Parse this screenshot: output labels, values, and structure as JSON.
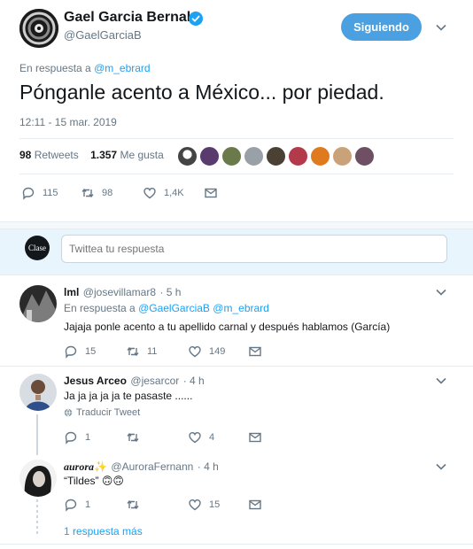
{
  "tweet": {
    "author_name": "Gael Garcia Bernal",
    "author_handle": "@GaelGarciaB",
    "follow_label": "Siguiendo",
    "reply_prefix": "En respuesta a",
    "reply_to": "@m_ebrard",
    "text": "Pónganle acento a México... por piedad.",
    "timestamp": "12:11 - 15 mar. 2019",
    "retweets_count": "98",
    "retweets_label": "Retweets",
    "likes_count": "1.357",
    "likes_label": "Me gusta",
    "actions": {
      "replies": "115",
      "retweets": "98",
      "likes": "1,4K"
    }
  },
  "compose": {
    "avatar_text": "Clase",
    "placeholder": "Twittea tu respuesta"
  },
  "replies": [
    {
      "name": "lml",
      "handle": "@josevillamar8",
      "time": "· 5 h",
      "reply_prefix": "En respuesta a",
      "reply_to_1": "@GaelGarciaB",
      "reply_to_2": "@m_ebrard",
      "text": "Jajaja ponle acento a tu apellido carnal y después hablamos (García)",
      "replies": "15",
      "retweets": "11",
      "likes": "149"
    },
    {
      "name": "Jesus Arceo",
      "handle": "@jesarcor",
      "time": "· 4 h",
      "text": "Ja ja ja ja ja te pasaste ......",
      "translate": "Traducir Tweet",
      "replies": "1",
      "retweets": "",
      "likes": "4"
    },
    {
      "name": "aurora",
      "name_emoji": "✨",
      "handle": "@AuroraFernann",
      "time": "· 4 h",
      "text": "“Tildes” 🙃🙃",
      "replies": "1",
      "retweets": "",
      "likes": "15"
    }
  ],
  "more_replies": "1 respuesta más",
  "colors": {
    "accent": "#1da1f2",
    "follow_button": "#4aa0e0",
    "muted": "#657786",
    "compose_bg": "#e8f5fd"
  }
}
